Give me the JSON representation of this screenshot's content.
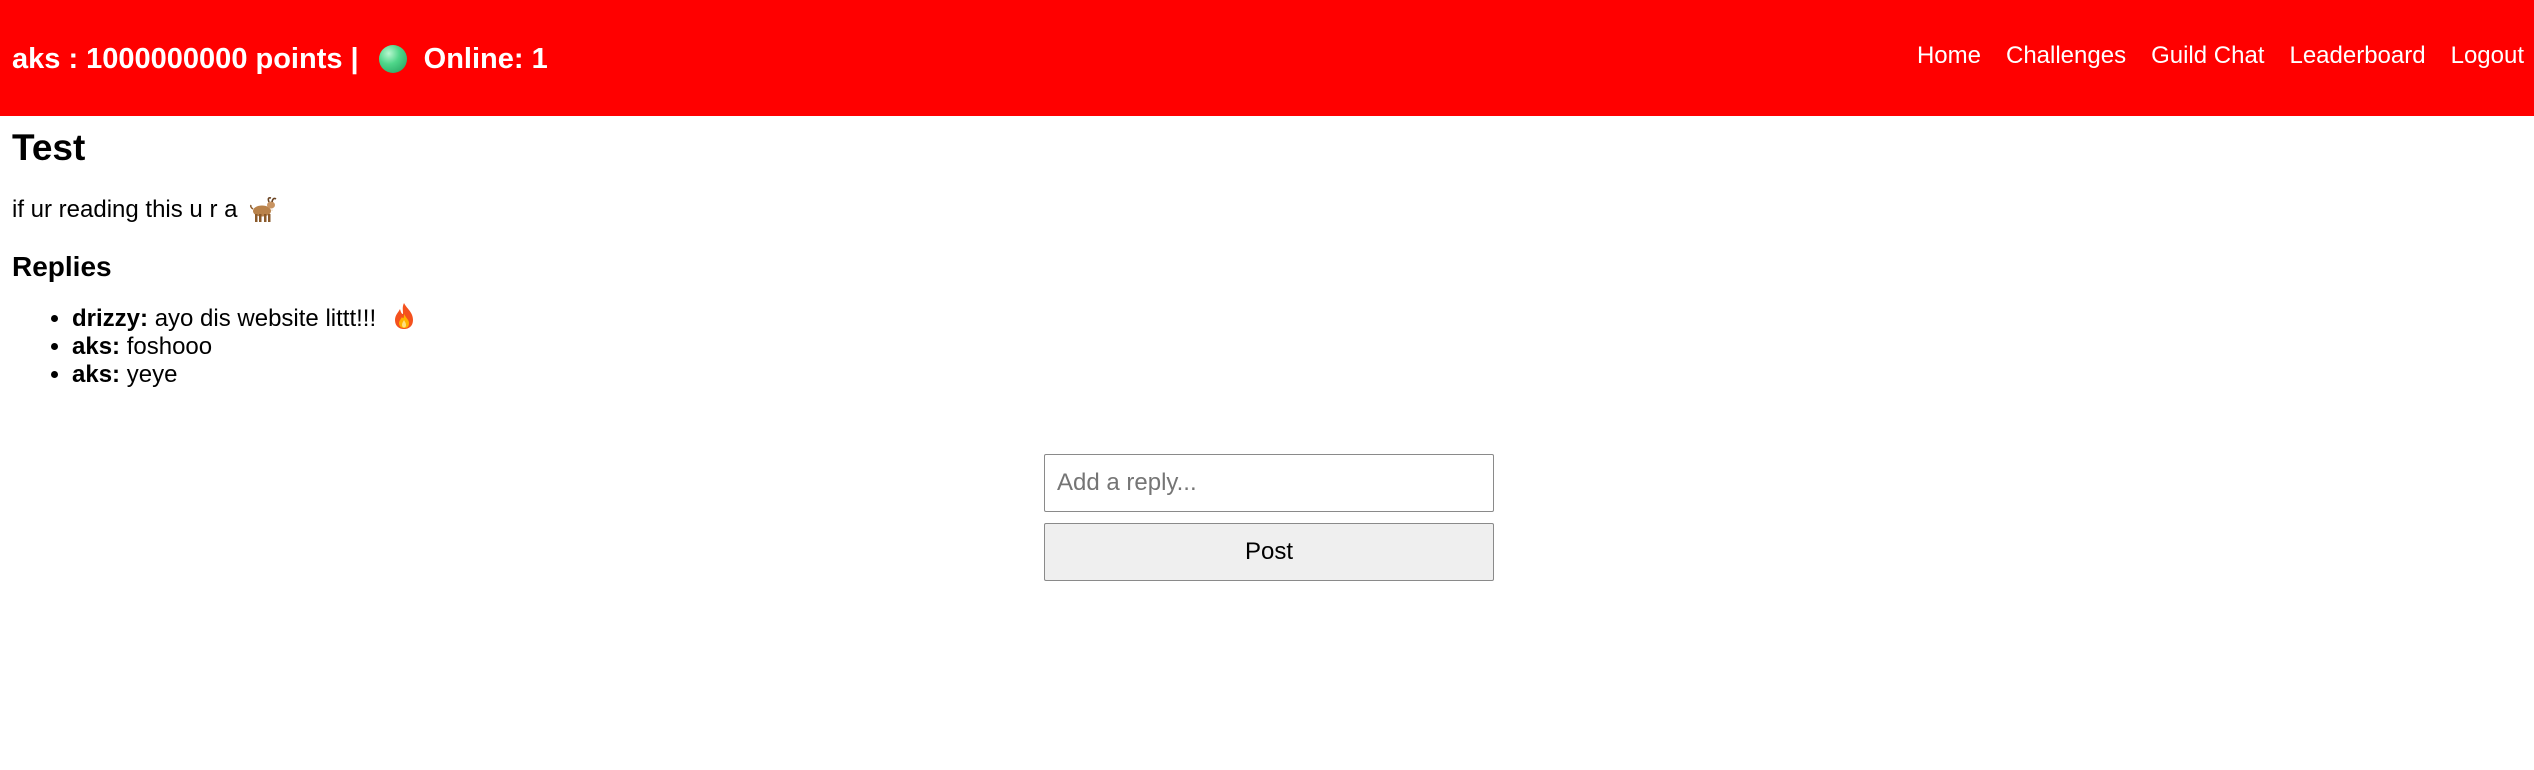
{
  "header": {
    "user_status": "aks : 1000000000 points |",
    "online_label": "Online: 1",
    "online_indicator_icon": "green-circle-icon",
    "background_color": "#ff0000",
    "nav": [
      {
        "label": "Home"
      },
      {
        "label": "Challenges"
      },
      {
        "label": "Guild Chat"
      },
      {
        "label": "Leaderboard"
      },
      {
        "label": "Logout"
      }
    ]
  },
  "post": {
    "title": "Test",
    "body": "if ur reading this u r a",
    "body_emoji_icon": "goat-icon"
  },
  "replies": {
    "heading": "Replies",
    "items": [
      {
        "author": "drizzy:",
        "text": "ayo dis website littt!!!",
        "emoji_icon": "fire-icon"
      },
      {
        "author": "aks:",
        "text": "foshooo"
      },
      {
        "author": "aks:",
        "text": "yeye"
      }
    ]
  },
  "reply_form": {
    "placeholder": "Add a reply...",
    "value": "",
    "submit_label": "Post"
  }
}
